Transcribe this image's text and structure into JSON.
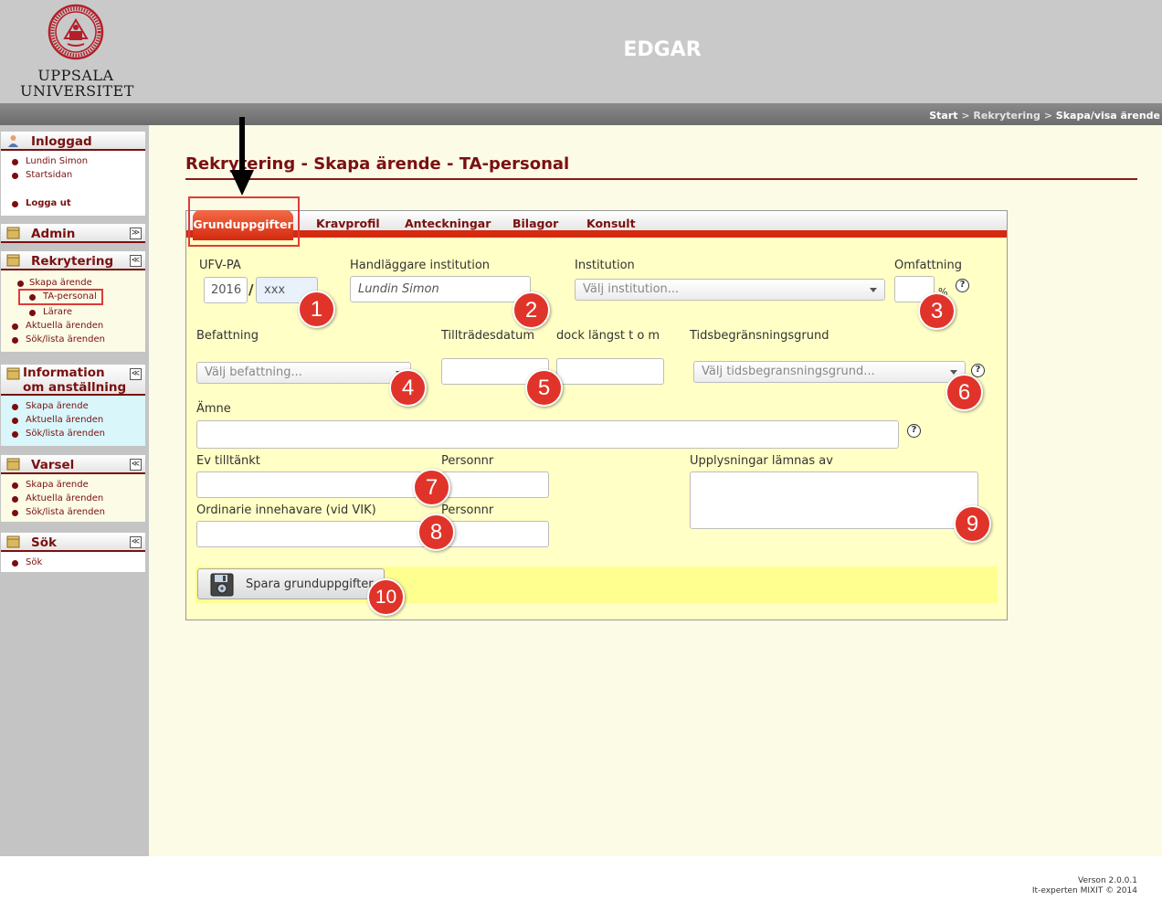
{
  "header": {
    "logo_line1": "UPPSALA",
    "logo_line2": "UNIVERSITET",
    "app_title": "EDGAR"
  },
  "breadcrumb": {
    "start": "Start",
    "separator": ">",
    "recruitment": "Rekrytering",
    "current": "Skapa/visa ärende"
  },
  "sidebar": {
    "inloggad": {
      "title": "Inloggad",
      "items": [
        "Lundin Simon",
        "Startsidan",
        "Logga ut"
      ]
    },
    "admin": {
      "title": "Admin"
    },
    "rekrytering": {
      "title": "Rekrytering",
      "items": [
        "Skapa ärende",
        "TA-personal",
        "Lärare",
        "Aktuella ärenden",
        "Sök/lista ärenden"
      ]
    },
    "information": {
      "title_line1": "Information",
      "title_line2": "om anställning",
      "items": [
        "Skapa ärende",
        "Aktuella ärenden",
        "Sök/lista ärenden"
      ]
    },
    "varsel": {
      "title": "Varsel",
      "items": [
        "Skapa ärende",
        "Aktuella ärenden",
        "Sök/lista ärenden"
      ]
    },
    "sok": {
      "title": "Sök",
      "items": [
        "Sök"
      ]
    }
  },
  "page": {
    "title": "Rekrytering - Skapa ärende - TA-personal"
  },
  "tabs": [
    "Grunduppgifter",
    "Kravprofil",
    "Anteckningar",
    "Bilagor",
    "Konsult"
  ],
  "form": {
    "ufv_label": "UFV-PA",
    "ufv_year": "2016",
    "ufv_number": "xxx",
    "ufv_slash": "/",
    "handlaggare_label": "Handläggare institution",
    "handlaggare_value": "Lundin Simon",
    "institution_label": "Institution",
    "institution_placeholder": "Välj institution...",
    "omfattning_label": "Omfattning",
    "percent": "%",
    "befattning_label": "Befattning",
    "befattning_placeholder": "Välj befattning...",
    "tilltrade_label": "Tillträdesdatum",
    "dock_label": "dock längst t o m",
    "tidsbegr_label": "Tidsbegränsningsgrund",
    "tidsbegr_placeholder": "Välj tidsbegransningsgrund...",
    "amne_label": "Ämne",
    "ev_tilltankt_label": "Ev tilltänkt",
    "personnr_label_1": "Personnr",
    "upplysningar_label": "Upplysningar lämnas av",
    "ordinarie_label": "Ordinarie innehavare (vid VIK)",
    "personnr_label_2": "Personnr",
    "help": "?",
    "save_button": "Spara grunduppgifter"
  },
  "callouts": [
    "1",
    "2",
    "3",
    "4",
    "5",
    "6",
    "7",
    "8",
    "9",
    "10"
  ],
  "footer": {
    "version": "Verson 2.0.0.1",
    "copyright": "It-experten MIXIT © 2014"
  },
  "colors": {
    "brand": "#7a1010",
    "tab_active": "#d42a10",
    "callout": "#e0342a",
    "form_bg": "#ffffc6"
  },
  "icons": [
    "university-seal-icon",
    "user-icon",
    "box-icon",
    "collapse-icon",
    "chevron-down-icon",
    "help-icon",
    "floppy-disk-icon",
    "arrow-down-icon"
  ]
}
